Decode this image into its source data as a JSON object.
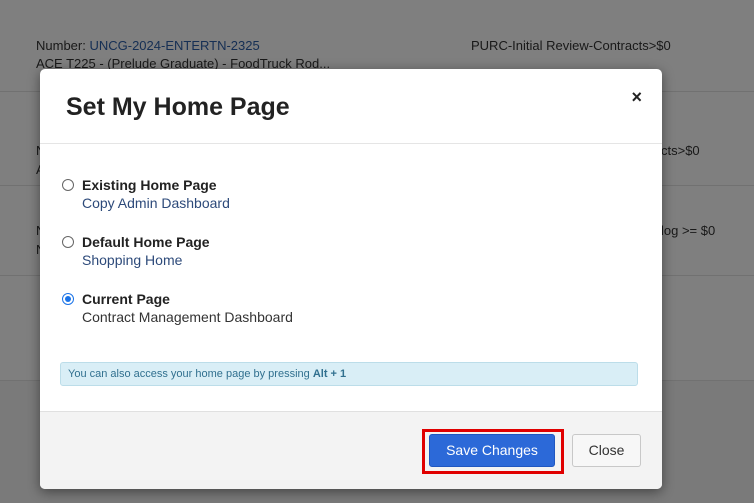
{
  "background": {
    "row1": {
      "number_label": "Number: ",
      "number_value": "UNCG-2024-ENTERTN-2325",
      "subtitle": "ACE T225 - (Prelude Graduate) -  FoodTruck Rod...",
      "workflow": "PURC-Initial Review-Contracts>$0"
    },
    "row2": {
      "left_edge_top": "N",
      "left_edge_bottom": "A",
      "workflow_tail": "cts>$0"
    },
    "row3": {
      "left_edge_top": "N",
      "left_edge_bottom": "N",
      "workflow_tail": "log >= $0"
    }
  },
  "modal": {
    "title": "Set My Home Page",
    "close_symbol": "×",
    "options": [
      {
        "label": "Existing Home Page",
        "sub": "Copy Admin Dashboard",
        "checked": false
      },
      {
        "label": "Default Home Page",
        "sub": "Shopping Home",
        "checked": false
      },
      {
        "label": "Current Page",
        "sub": "Contract Management Dashboard",
        "checked": true
      }
    ],
    "info_text": "You can also access your home page by pressing ",
    "info_shortcut": "Alt + 1",
    "save_label": "Save Changes",
    "close_label": "Close"
  },
  "colors": {
    "primary_button": "#2c69d8",
    "highlight_box": "#e00000",
    "info_background": "#d9eef6"
  }
}
